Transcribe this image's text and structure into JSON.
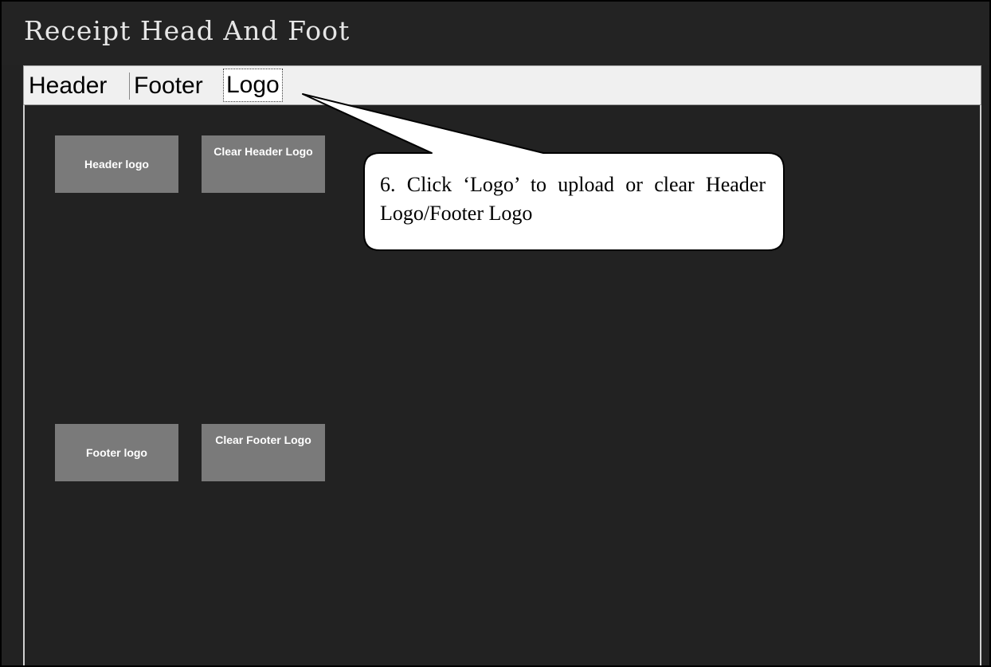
{
  "window": {
    "title": "Receipt Head And Foot"
  },
  "tabs": [
    {
      "label": "Header",
      "selected": false
    },
    {
      "label": "Footer",
      "selected": false
    },
    {
      "label": "Logo",
      "selected": true
    }
  ],
  "buttons": {
    "header_logo": "Header logo",
    "clear_header_logo": "Clear Header Logo",
    "footer_logo": "Footer logo",
    "clear_footer_logo": "Clear Footer Logo"
  },
  "callout": {
    "text": "6. Click ‘Logo’ to upload or clear Header Logo/Footer Logo"
  },
  "colors": {
    "background": "#222222",
    "button": "#7a7a7a",
    "tabstrip": "#f0f0f0"
  }
}
